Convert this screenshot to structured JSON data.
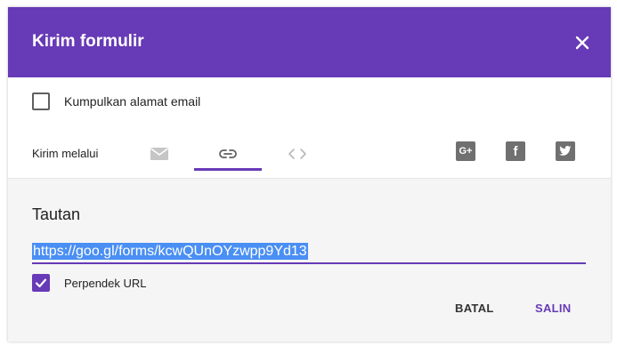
{
  "dialog": {
    "title": "Kirim formulir",
    "close_icon": "close-icon",
    "collect_email": {
      "label": "Kumpulkan alamat email",
      "checked": false
    },
    "send_via": {
      "label": "Kirim melalui",
      "tabs": [
        {
          "icon": "email-icon",
          "selected": false
        },
        {
          "icon": "link-icon",
          "selected": true
        },
        {
          "icon": "embed-code-icon",
          "selected": false
        }
      ],
      "social": [
        {
          "icon": "google-plus-icon",
          "text": "G+"
        },
        {
          "icon": "facebook-icon",
          "text": "f"
        },
        {
          "icon": "twitter-icon"
        }
      ]
    },
    "link_section": {
      "title": "Tautan",
      "url": "https://goo.gl/forms/kcwQUnOYzwpp9Yd13",
      "shorten": {
        "label": "Perpendek URL",
        "checked": true
      }
    },
    "actions": {
      "cancel": "BATAL",
      "copy": "SALIN"
    }
  },
  "colors": {
    "accent": "#673ab7",
    "selection": "#4a8ff3",
    "icon_gray": "#707070"
  }
}
